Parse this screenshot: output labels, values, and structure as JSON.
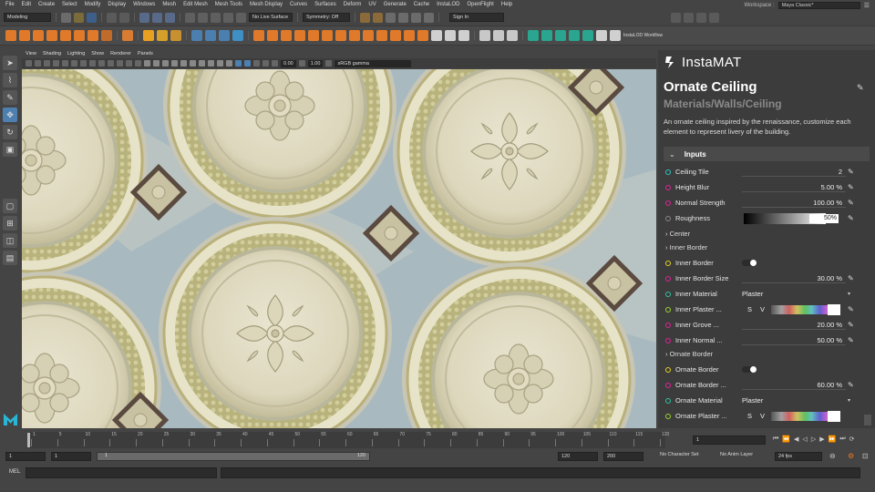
{
  "menu": [
    "Modeling",
    "File",
    "Edit",
    "Create",
    "Select",
    "Modify",
    "Display",
    "Windows",
    "Mesh",
    "Edit Mesh",
    "Mesh Tools",
    "Mesh Display",
    "Curves",
    "Surfaces",
    "Deform",
    "UV",
    "Generate",
    "Cache",
    "InstaLOD",
    "OpenFlight",
    "Help"
  ],
  "workspace": {
    "label": "Workspace :",
    "value": "Maya Classic*"
  },
  "statusline": {
    "mode": "Modeling",
    "live_surface": "No Live Surface",
    "symmetry": "Symmetry: Off",
    "sign_in": "Sign In"
  },
  "shelf": {
    "last_label": "InstaLOD Workflow"
  },
  "viewport_menu": [
    "View",
    "Shading",
    "Lighting",
    "Show",
    "Renderer",
    "Panels"
  ],
  "viewport_toolbar": {
    "near": "0.00",
    "far": "1.00",
    "color_space": "sRGB gamma"
  },
  "panel": {
    "brand": "InstaMAT",
    "title": "Ornate Ceiling",
    "subtitle": "Materials/Walls/Ceiling",
    "description": "An ornate ceiling inspired by the renaissance, customize each element to represent livery of the building.",
    "inputs_label": "Inputs",
    "rows": [
      {
        "label": "Ceiling Tile",
        "value": "2",
        "color": "#2ec4c4"
      },
      {
        "label": "Height Blur",
        "value": "5.00 %",
        "color": "#e0239a"
      },
      {
        "label": "Normal Strength",
        "value": "100.00 %",
        "color": "#e0239a"
      },
      {
        "label": "Roughness",
        "value": "50%",
        "color": "#888888"
      }
    ],
    "center_label": "Center",
    "inner_border_group": "Inner Border",
    "inner_rows": [
      {
        "label": "Inner Border",
        "value": "",
        "color": "#e6d21e"
      },
      {
        "label": "Inner Border Size",
        "value": "30.00 %",
        "color": "#e0239a"
      },
      {
        "label": "Inner Material",
        "value": "Plaster",
        "color": "#2ec4a0"
      },
      {
        "label": "Inner Plaster ...",
        "value": "",
        "color": "#9ad62a"
      },
      {
        "label": "Inner Grove ...",
        "value": "20.00 %",
        "color": "#e0239a"
      },
      {
        "label": "Inner Normal ...",
        "value": "50.00 %",
        "color": "#e0239a"
      }
    ],
    "ornate_border_group": "Ornate Border",
    "ornate_rows": [
      {
        "label": "Ornate Border",
        "value": "",
        "color": "#e6d21e"
      },
      {
        "label": "Ornate Border ...",
        "value": "60.00 %",
        "color": "#e0239a"
      },
      {
        "label": "Ornate Material",
        "value": "Plaster",
        "color": "#2ec4a0"
      },
      {
        "label": "Ornate Plaster ...",
        "value": "",
        "color": "#9ad62a"
      }
    ],
    "sv_s": "S",
    "sv_v": "V"
  },
  "timeline": {
    "ticks": [
      "1",
      "5",
      "10",
      "15",
      "20",
      "25",
      "30",
      "35",
      "40",
      "45",
      "50",
      "55",
      "60",
      "65",
      "70",
      "75",
      "80",
      "85",
      "90",
      "95",
      "100",
      "105",
      "110",
      "115",
      "120"
    ],
    "current": "1"
  },
  "range": {
    "start": "1",
    "inner_start": "1",
    "bar_start": "1",
    "bar_end": "120",
    "end": "120",
    "anim_end": "200",
    "character_set": "No Character Set",
    "anim_layer": "No Anim Layer",
    "fps": "24 fps"
  },
  "cmd": {
    "label": "MEL"
  }
}
